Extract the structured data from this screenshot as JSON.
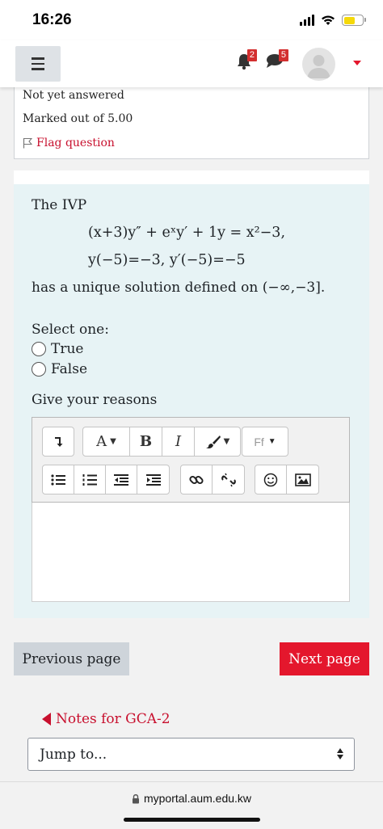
{
  "status_bar": {
    "time": "16:26"
  },
  "navbar": {
    "notifications_count": "2",
    "messages_count": "5",
    "icons": [
      "menu-icon",
      "bell-icon",
      "chat-icon",
      "avatar",
      "caret-down-icon"
    ],
    "accent_color": "#e4172d"
  },
  "question_info": {
    "status": "Not yet answered",
    "marks": "Marked out of 5.00",
    "flag_label": "Flag question"
  },
  "question": {
    "intro": "The IVP",
    "equation": "(x+3)y″ + eˣy′ + 1y = x²−3,",
    "initial_conditions": "y(−5)=−3,  y′(−5)=−5",
    "statement": "has a unique solution defined on (−∞,−3].",
    "prompt": "Select one:",
    "options": [
      "True",
      "False"
    ],
    "reasons_label": "Give your reasons"
  },
  "editor": {
    "toolbar_row1": [
      "collapse-icon",
      "A▾",
      "B",
      "I",
      "brush-icon",
      "Ff▾"
    ],
    "toolbar_row2": [
      "unordered-list-icon",
      "ordered-list-icon",
      "outdent-icon",
      "indent-icon",
      "link-icon",
      "unlink-icon",
      "emoji-icon",
      "image-icon"
    ],
    "font_color_label": "A",
    "bold_label": "B",
    "italic_label": "I",
    "font_family_label": "Ff"
  },
  "navigation": {
    "previous_label": "Previous page",
    "next_label": "Next page",
    "notes_link": "Notes for GCA-2",
    "jump_placeholder": "Jump to..."
  },
  "browser": {
    "url": "myportal.aum.edu.kw"
  }
}
